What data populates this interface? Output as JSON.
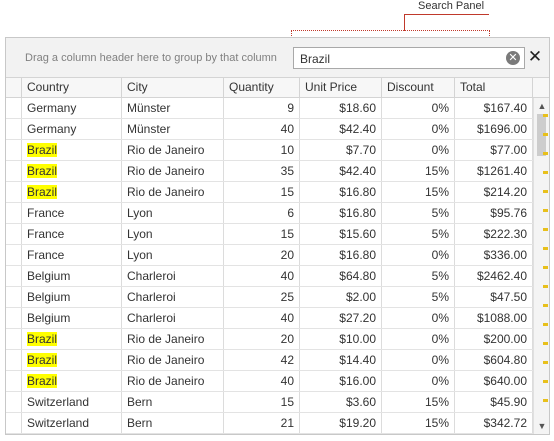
{
  "annotation": {
    "callout_label": "Search Panel"
  },
  "panel": {
    "group_hint": "Drag a column header here to group by that column",
    "search_value": "Brazil",
    "clear_icon": "clear-circle-icon",
    "clear_glyph": "✕",
    "close_icon": "close-icon",
    "close_glyph": "✕"
  },
  "columns": [
    "Country",
    "City",
    "Quantity",
    "Unit Price",
    "Discount",
    "Total"
  ],
  "highlight": {
    "term": "Brazil",
    "color": "#ffff00"
  },
  "rows": [
    [
      "Germany",
      "Münster",
      "9",
      "$18.60",
      "0%",
      "$167.40"
    ],
    [
      "Germany",
      "Münster",
      "40",
      "$42.40",
      "0%",
      "$1696.00"
    ],
    [
      "Brazil",
      "Rio de Janeiro",
      "10",
      "$7.70",
      "0%",
      "$77.00"
    ],
    [
      "Brazil",
      "Rio de Janeiro",
      "35",
      "$42.40",
      "15%",
      "$1261.40"
    ],
    [
      "Brazil",
      "Rio de Janeiro",
      "15",
      "$16.80",
      "15%",
      "$214.20"
    ],
    [
      "France",
      "Lyon",
      "6",
      "$16.80",
      "5%",
      "$95.76"
    ],
    [
      "France",
      "Lyon",
      "15",
      "$15.60",
      "5%",
      "$222.30"
    ],
    [
      "France",
      "Lyon",
      "20",
      "$16.80",
      "0%",
      "$336.00"
    ],
    [
      "Belgium",
      "Charleroi",
      "40",
      "$64.80",
      "5%",
      "$2462.40"
    ],
    [
      "Belgium",
      "Charleroi",
      "25",
      "$2.00",
      "5%",
      "$47.50"
    ],
    [
      "Belgium",
      "Charleroi",
      "40",
      "$27.20",
      "0%",
      "$1088.00"
    ],
    [
      "Brazil",
      "Rio de Janeiro",
      "20",
      "$10.00",
      "0%",
      "$200.00"
    ],
    [
      "Brazil",
      "Rio de Janeiro",
      "42",
      "$14.40",
      "0%",
      "$604.80"
    ],
    [
      "Brazil",
      "Rio de Janeiro",
      "40",
      "$16.00",
      "0%",
      "$640.00"
    ],
    [
      "Switzerland",
      "Bern",
      "15",
      "$3.60",
      "15%",
      "$45.90"
    ],
    [
      "Switzerland",
      "Bern",
      "21",
      "$19.20",
      "15%",
      "$342.72"
    ]
  ],
  "scrollbar": {
    "up_icon": "scroll-up-arrow-icon",
    "up_glyph": "▲",
    "down_icon": "scroll-down-arrow-icon",
    "down_glyph": "▼",
    "match_mark_color": "#e8c01b"
  }
}
